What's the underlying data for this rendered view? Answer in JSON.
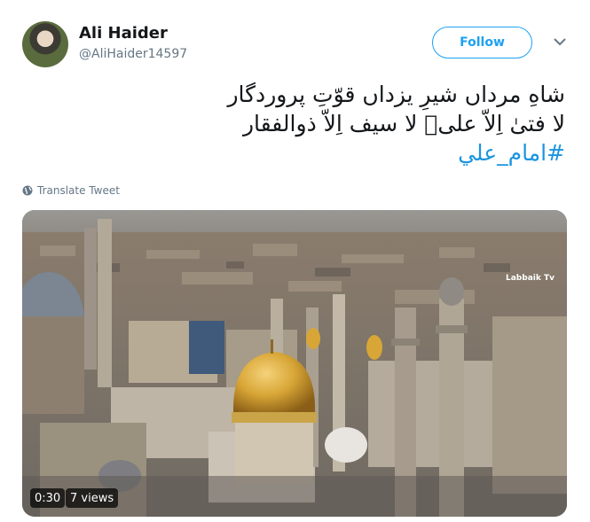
{
  "author": {
    "name": "Ali Haider",
    "handle": "@AliHaider14597"
  },
  "follow_label": "Follow",
  "tweet": {
    "line1": "شاهِ مرداں شیرِ یزداں قوّتِ پروردگار",
    "line2": "لا فتیٰ اِلاّ علیؑ لا سیف اِلاّ ذوالفقار",
    "hashtag": "#امام_علي"
  },
  "translate_label": "Translate Tweet",
  "video": {
    "duration": "0:30",
    "views": "7 views",
    "channel_logo_text": "Labbaik Tv"
  },
  "colors": {
    "accent": "#1da1f2",
    "hashtag": "#1b95e0",
    "secondary_text": "#657786",
    "dome_gold": "#d8a637"
  }
}
